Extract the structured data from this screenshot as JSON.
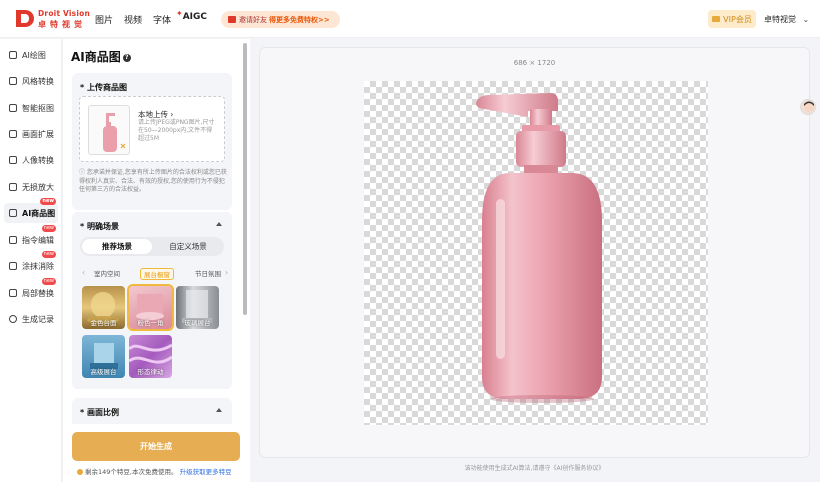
{
  "header": {
    "brand_en": "Droit Vision",
    "brand_cn": "卓特视觉",
    "nav": [
      "图片",
      "视频",
      "字体"
    ],
    "aigc": "AIGC",
    "promo_prefix": "邀请好友",
    "promo_highlight": "得更多免费特权>>",
    "vip": "VIP会员",
    "user": "卓特视觉"
  },
  "sidebar": {
    "items": [
      {
        "label": "AI绘图",
        "badge": ""
      },
      {
        "label": "风格转换",
        "badge": ""
      },
      {
        "label": "智能抠图",
        "badge": ""
      },
      {
        "label": "画面扩展",
        "badge": ""
      },
      {
        "label": "人像转换",
        "badge": ""
      },
      {
        "label": "无损放大",
        "badge": ""
      },
      {
        "label": "AI商品图",
        "badge": "new"
      },
      {
        "label": "指令编辑",
        "badge": "new"
      },
      {
        "label": "涂抹消除",
        "badge": "new"
      },
      {
        "label": "局部替换",
        "badge": "new"
      },
      {
        "label": "生成记录",
        "badge": ""
      }
    ],
    "active_index": 6
  },
  "panel": {
    "title": "AI商品图",
    "upload": {
      "title": "上传商品图",
      "action": "本地上传",
      "hint": "请上传JPEG或PNG图片,尺寸在50—2000px内,文件不得超过5M",
      "notice": "您承诺并保证,您享有所上传图片的合法权利或您已获得权利人真实、合法、有效的授权,您的使用行为不侵犯任何第三方的合法权益。"
    },
    "scene": {
      "title": "明确场景",
      "segments": [
        "推荐场景",
        "自定义场景"
      ],
      "tabs": [
        "室内空间",
        "展台橱窗",
        "节日氛围"
      ],
      "selected_tab": 1,
      "tiles": [
        "金色台面",
        "粉色一角",
        "玻璃展台",
        "高级展台",
        "形态律动"
      ]
    },
    "ratio": {
      "title": "画面比例"
    },
    "generate": "开始生成",
    "remain_text": "剩余149个特豆,本次免费使用。",
    "upgrade": "升级获取更多特豆"
  },
  "canvas": {
    "dimensions": "686 × 1720",
    "footer": "该功能使用生成式AI算法,请遵守《AI创作服务协议》"
  },
  "colors": {
    "brand_red": "#e0392b",
    "accent_orange": "#e7ad52",
    "bottle_pink": "#e99aa6"
  }
}
